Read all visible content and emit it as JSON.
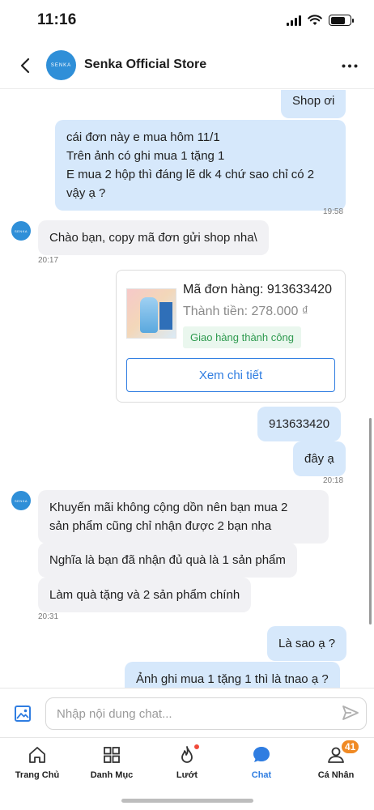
{
  "status_bar": {
    "time": "11:16"
  },
  "header": {
    "title": "Senka Official Store",
    "avatar_text": "SENKA"
  },
  "messages": [
    {
      "id": "m1",
      "side": "out",
      "text": "Shop ơi"
    },
    {
      "id": "m2",
      "side": "out",
      "text": "cái đơn này e mua hôm 11/1\nTrên ảnh có ghi mua 1 tặng 1\nE mua 2 hộp thì đáng lẽ dk 4 chứ sao chỉ có 2\nvậy ạ ?",
      "time": "19:58"
    },
    {
      "id": "m3",
      "side": "in",
      "text": "Chào bạn, copy mã đơn gửi shop nha\\",
      "time": "20:17"
    },
    {
      "id": "m4",
      "side": "out",
      "text": "913633420"
    },
    {
      "id": "m5",
      "side": "out",
      "text": "đây ạ",
      "time": "20:18"
    },
    {
      "id": "m6",
      "side": "in",
      "text": "Khuyến mãi không cộng dồn nên bạn mua 2\nsản phẩm cũng chỉ nhận được 2 bạn nha"
    },
    {
      "id": "m7",
      "side": "in",
      "text": "Nghĩa là bạn đã nhận đủ quà là 1 sản phẩm"
    },
    {
      "id": "m8",
      "side": "in",
      "text": "Làm quà tặng và 2 sản phẩm chính",
      "time": "20:31"
    },
    {
      "id": "m9",
      "side": "out",
      "text": "Là sao ạ ?"
    },
    {
      "id": "m10",
      "side": "out",
      "text": "Ảnh ghi mua 1 tặng 1 thì là tnao ạ ?"
    }
  ],
  "order_card": {
    "code": "Mã đơn hàng: 913633420",
    "total": "Thành tiền: 278.000 ₫",
    "status": "Giao hàng thành công",
    "button_label": "Xem chi tiết"
  },
  "input": {
    "placeholder": "Nhập nội dung chat..."
  },
  "tabs": [
    {
      "label": "Trang Chủ",
      "icon": "home-icon"
    },
    {
      "label": "Danh Mục",
      "icon": "grid-icon"
    },
    {
      "label": "Lướt",
      "icon": "flame-icon"
    },
    {
      "label": "Chat",
      "icon": "chat-bubble-icon",
      "active": true
    },
    {
      "label": "Cá Nhân",
      "icon": "profile-icon",
      "badge": "41"
    }
  ],
  "colors": {
    "accent": "#2f7de1",
    "outgoing_bubble": "#d6e8fb",
    "incoming_bubble": "#f1f1f4",
    "badge": "#f08a24",
    "success": "#2e9a4f"
  }
}
